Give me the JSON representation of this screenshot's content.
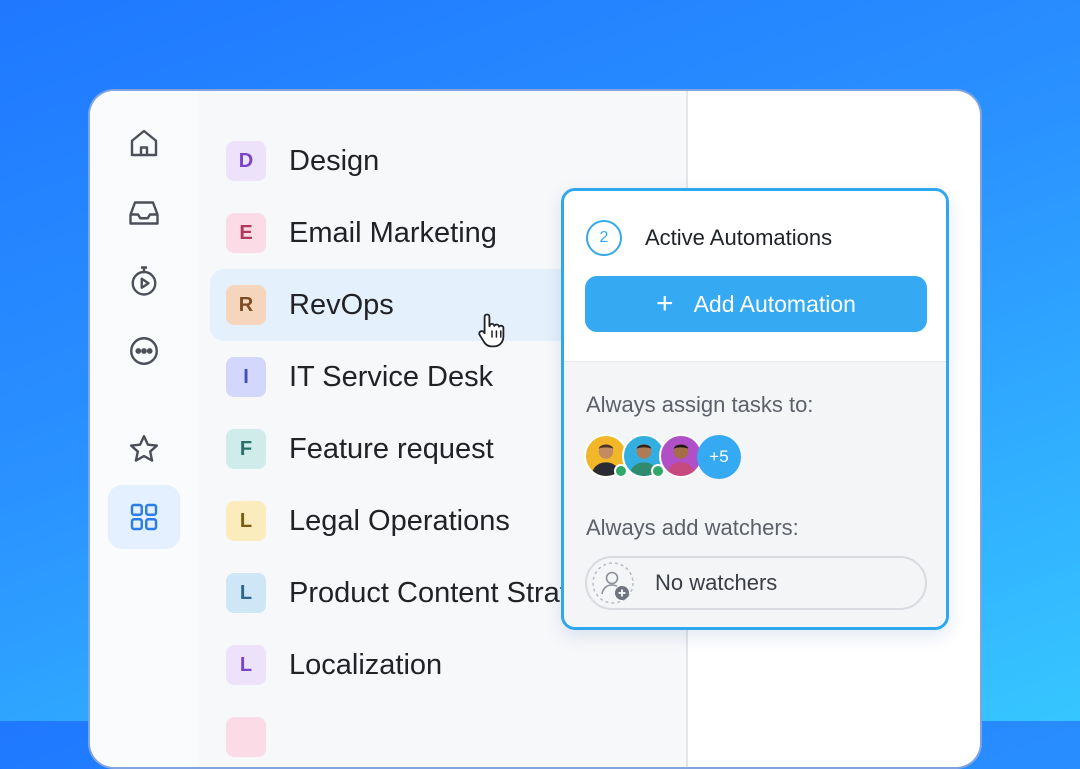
{
  "rail": {
    "icons": [
      "home-icon",
      "inbox-icon",
      "timer-icon",
      "more-icon",
      "star-icon",
      "spaces-grid-icon"
    ],
    "active": "spaces-grid-icon"
  },
  "spaces": [
    {
      "letter": "D",
      "label": "Design",
      "badge_bg": "#ece3fb",
      "badge_fg": "#7a44c9"
    },
    {
      "letter": "E",
      "label": "Email Marketing",
      "badge_bg": "#fbdbe6",
      "badge_fg": "#b03a5e"
    },
    {
      "letter": "R",
      "label": "RevOps",
      "badge_bg": "#f6d5bd",
      "badge_fg": "#7d4a25"
    },
    {
      "letter": "I",
      "label": "IT Service Desk",
      "badge_bg": "#d3d7fb",
      "badge_fg": "#4450b8"
    },
    {
      "letter": "F",
      "label": "Feature request",
      "badge_bg": "#cfeceb",
      "badge_fg": "#27706b"
    },
    {
      "letter": "L",
      "label": "Legal Operations",
      "badge_bg": "#fbecbd",
      "badge_fg": "#7a5b12"
    },
    {
      "letter": "L",
      "label": "Product Content Strategy",
      "badge_bg": "#cfe6f7",
      "badge_fg": "#2a6690"
    },
    {
      "letter": "L",
      "label": "Localization",
      "badge_bg": "#ece3fb",
      "badge_fg": "#7a44c9"
    },
    {
      "letter": "",
      "label": "",
      "badge_bg": "#fbdbe6",
      "badge_fg": "#b03a5e"
    }
  ],
  "hovered_space": "RevOps",
  "popup": {
    "count": "2",
    "title": "Active Automations",
    "add_button": {
      "icon": "plus-icon",
      "label": "Add Automation"
    },
    "assign_label": "Always assign tasks to:",
    "assignees_more": "+5",
    "watchers_label": "Always add watchers:",
    "watchers_value": "No watchers"
  },
  "colors": {
    "accent": "#36a9f3",
    "popup_border": "#2da8f0",
    "online": "#2fa868"
  }
}
